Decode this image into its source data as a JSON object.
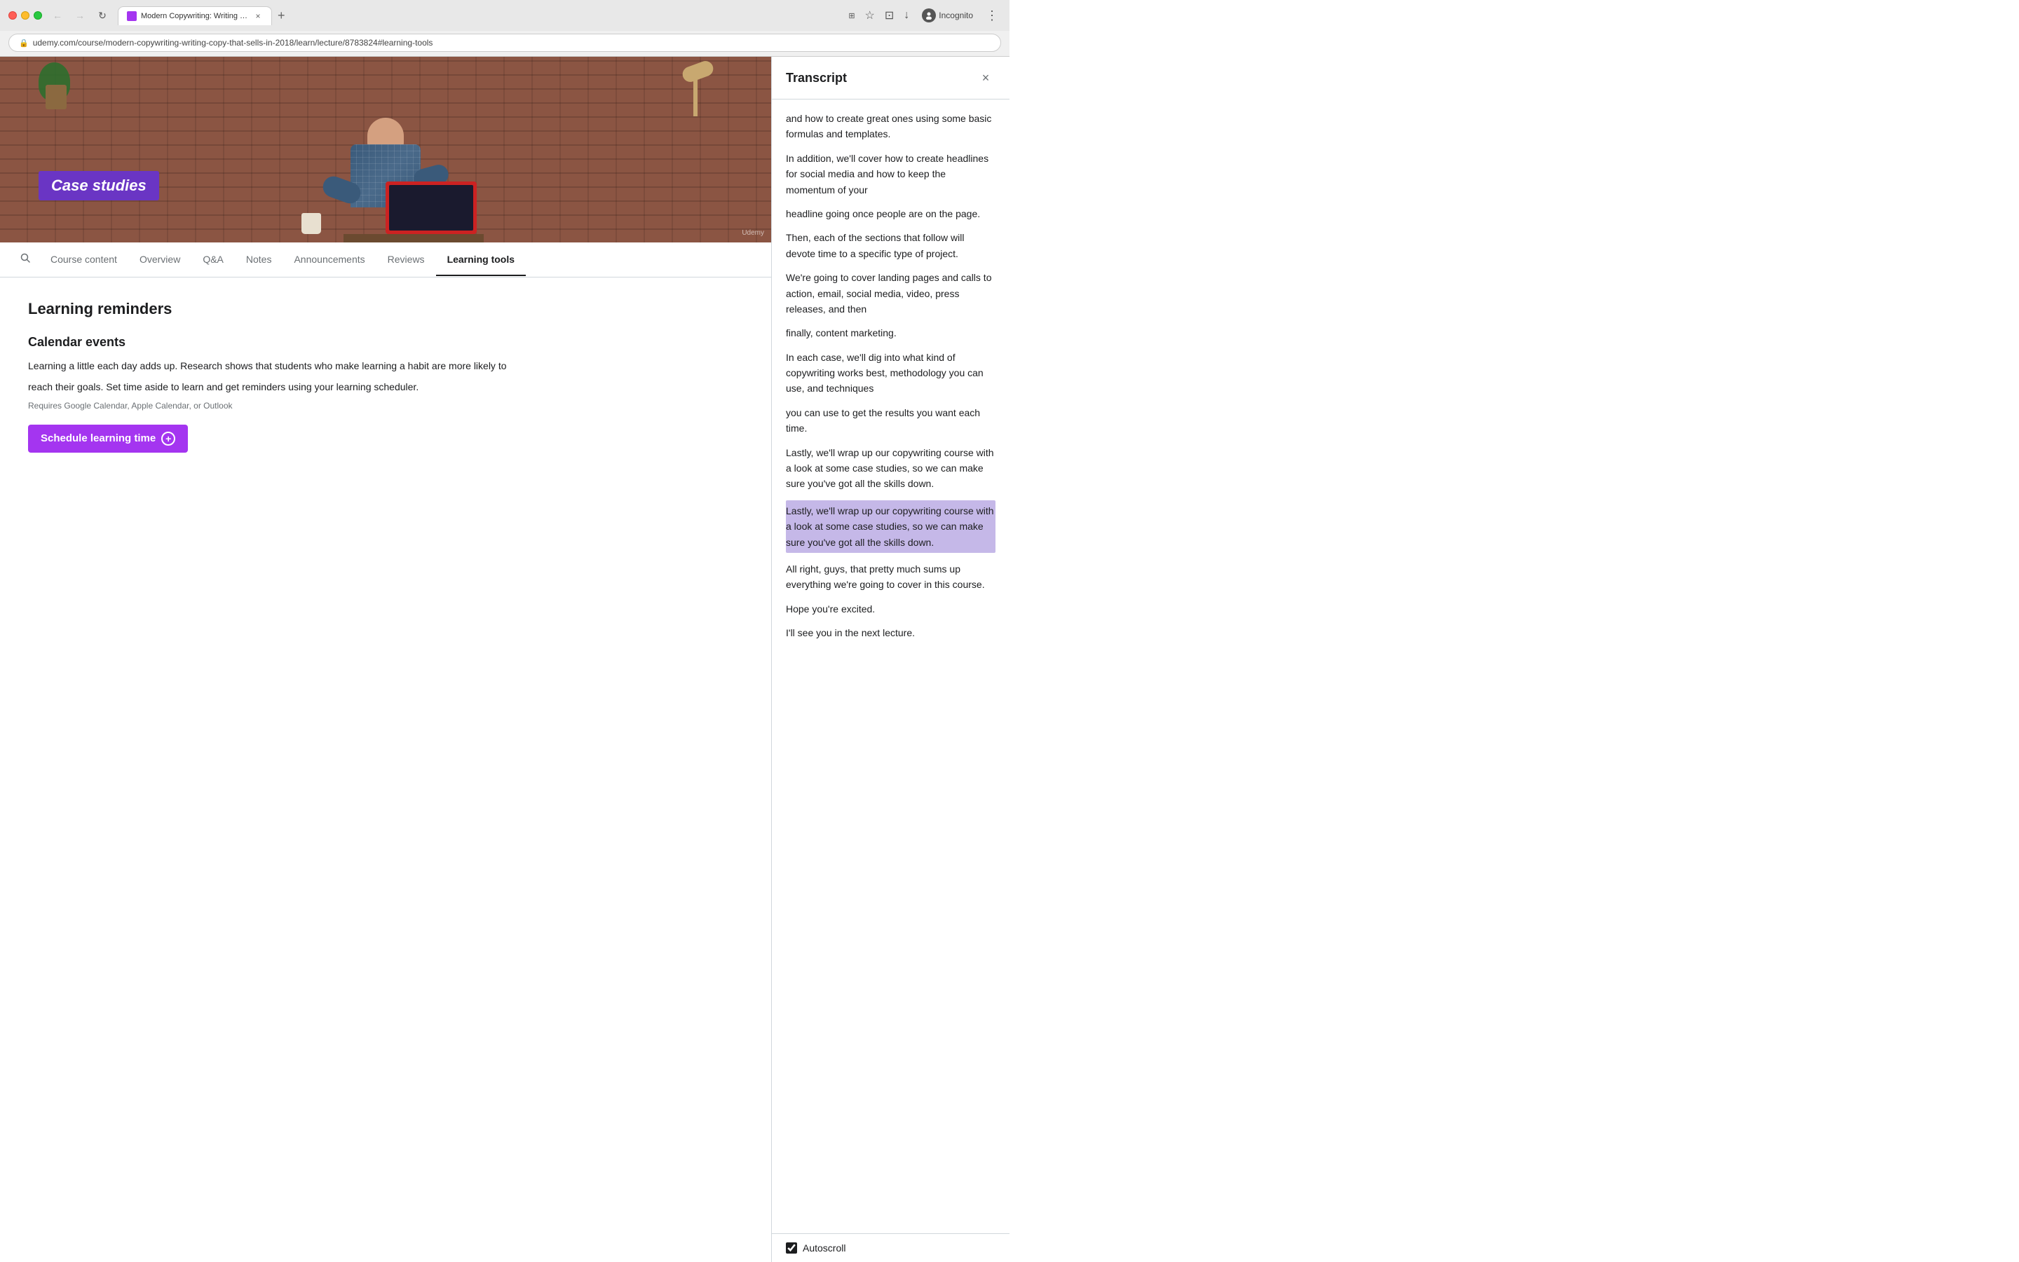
{
  "browser": {
    "tab_title": "Modern Copywriting: Writing c...",
    "url": "udemy.com/course/modern-copywriting-writing-copy-that-sells-in-2018/learn/lecture/8783824#learning-tools",
    "incognito_label": "Incognito"
  },
  "video": {
    "case_studies_label": "Case studies",
    "udemy_watermark": "Udemy"
  },
  "nav_tabs": {
    "search_label": "🔍",
    "items": [
      {
        "id": "course-content",
        "label": "Course content",
        "active": false
      },
      {
        "id": "overview",
        "label": "Overview",
        "active": false
      },
      {
        "id": "qa",
        "label": "Q&A",
        "active": false
      },
      {
        "id": "notes",
        "label": "Notes",
        "active": false
      },
      {
        "id": "announcements",
        "label": "Announcements",
        "active": false
      },
      {
        "id": "reviews",
        "label": "Reviews",
        "active": false
      },
      {
        "id": "learning-tools",
        "label": "Learning tools",
        "active": true
      }
    ]
  },
  "page": {
    "section_title": "Learning reminders",
    "subsection_title": "Calendar events",
    "description_line1": "Learning a little each day adds up. Research shows that students who make learning a habit are more likely to",
    "description_line2": "reach their goals. Set time aside to learn and get reminders using your learning scheduler.",
    "requires_text": "Requires Google Calendar, Apple Calendar, or Outlook",
    "schedule_button_label": "Schedule learning time"
  },
  "transcript": {
    "title": "Transcript",
    "close_label": "×",
    "paragraphs": [
      {
        "id": 1,
        "text": "and how to create great ones using some basic formulas and templates.",
        "highlighted": false
      },
      {
        "id": 2,
        "text": "In addition, we'll cover how to create headlines for social media and how to keep the momentum of your",
        "highlighted": false
      },
      {
        "id": 3,
        "text": "headline going once people are on the page.",
        "highlighted": false
      },
      {
        "id": 4,
        "text": "Then, each of the sections that follow will devote time to a specific type of project.",
        "highlighted": false
      },
      {
        "id": 5,
        "text": "We're going to cover landing pages and calls to action, email, social media, video, press releases, and then",
        "highlighted": false
      },
      {
        "id": 6,
        "text": "finally, content marketing.",
        "highlighted": false
      },
      {
        "id": 7,
        "text": "In each case, we'll dig into what kind of copywriting works best, methodology you can use, and techniques",
        "highlighted": false
      },
      {
        "id": 8,
        "text": "you can use to get the results you want each time.",
        "highlighted": false
      },
      {
        "id": 9,
        "text": "Lastly, we'll wrap up our copywriting course with a look at some case studies, so we can make sure you've got all the skills down.",
        "highlighted": false
      },
      {
        "id": 10,
        "text": "Lastly, we'll wrap up our copywriting course with a look at some case studies, so we can make sure you've got all the skills down.",
        "highlighted": true
      },
      {
        "id": 11,
        "text": "All right, guys, that pretty much sums up everything we're going to cover in this course.",
        "highlighted": false
      },
      {
        "id": 12,
        "text": "Hope you're excited.",
        "highlighted": false
      },
      {
        "id": 13,
        "text": "I'll see you in the next lecture.",
        "highlighted": false
      }
    ],
    "autoscroll_label": "Autoscroll",
    "autoscroll_checked": true
  }
}
